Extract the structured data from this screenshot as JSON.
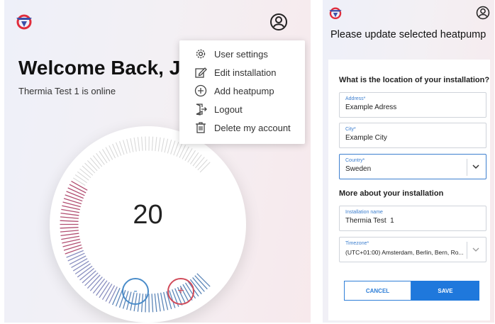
{
  "colors": {
    "accent_blue": "#1f78dc",
    "minus_blue": "#4a8cc9",
    "plus_red": "#d14b5a",
    "logo_blue": "#3b4fa8",
    "logo_red": "#e02d3c"
  },
  "home": {
    "logo_icon": "thermia-logo-icon",
    "user_icon": "user-circle-icon",
    "welcome": "Welcome Back, J",
    "status": "Thermia Test 1 is online",
    "temperature": "20",
    "minus_label": "-",
    "plus_label": "+"
  },
  "menu": {
    "items": [
      {
        "label": "User settings",
        "icon": "gear-icon"
      },
      {
        "label": "Edit installation",
        "icon": "edit-icon"
      },
      {
        "label": "Add heatpump",
        "icon": "plus-circle-icon"
      },
      {
        "label": "Logout",
        "icon": "logout-icon"
      },
      {
        "label": "Delete my account",
        "icon": "trash-icon"
      }
    ]
  },
  "edit": {
    "title": "Please update selected heatpump",
    "location_heading": "What is the location of your installation?",
    "address": {
      "label": "Address*",
      "value": "Example Adress"
    },
    "city": {
      "label": "City*",
      "value": "Example City"
    },
    "country": {
      "label": "Country*",
      "value": "Sweden"
    },
    "more_heading": "More about your installation",
    "installation_name": {
      "label": "Installation name",
      "value": "Thermia Test  1"
    },
    "timezone": {
      "label": "Timezone*",
      "value": "(UTC+01:00) Amsterdam, Berlin, Bern, Ro..."
    },
    "cancel_label": "CANCEL",
    "save_label": "SAVE"
  }
}
